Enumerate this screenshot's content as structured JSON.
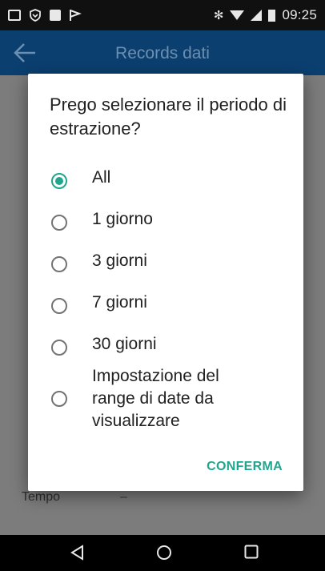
{
  "status_bar": {
    "time": "09:25",
    "icons": [
      "image-icon",
      "shield-icon",
      "square-icon",
      "flag-icon",
      "bluetooth-icon",
      "wifi-icon",
      "signal-icon",
      "battery-icon"
    ],
    "bluetooth_glyph": "✻"
  },
  "app_bar": {
    "title": "Records dati",
    "back_icon": "arrow-left-icon"
  },
  "background": {
    "last_row_label": "Tempo",
    "last_row_value": "–"
  },
  "dialog": {
    "title": "Prego selezionare il periodo di estrazione?",
    "options": [
      {
        "label": "All",
        "checked": true
      },
      {
        "label": "1 giorno",
        "checked": false
      },
      {
        "label": "3 giorni",
        "checked": false
      },
      {
        "label": "7 giorni",
        "checked": false
      },
      {
        "label": "30 giorni",
        "checked": false
      },
      {
        "label": "Impostazione del range di date da visualizzare",
        "checked": false
      }
    ],
    "confirm_label": "CONFERMA"
  },
  "nav_bar": {
    "icons": [
      "back-triangle-icon",
      "home-circle-icon",
      "recents-square-icon"
    ]
  },
  "colors": {
    "accent": "#20a68e",
    "app_bar": "#0b3f70",
    "scrim": "#7f7f7f"
  }
}
